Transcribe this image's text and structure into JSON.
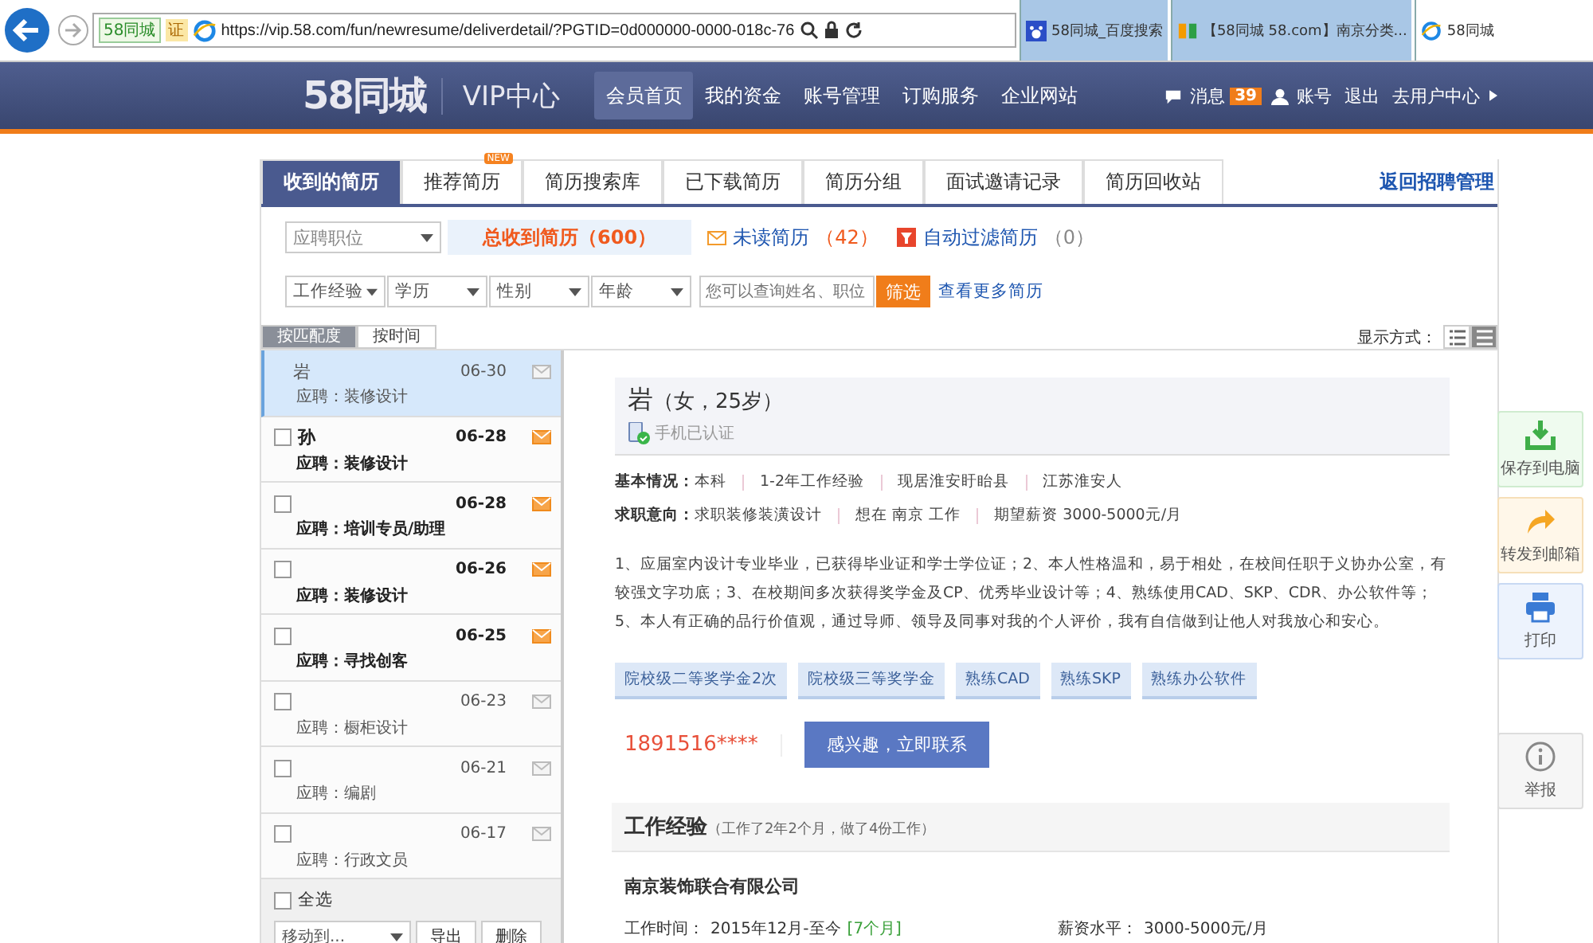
{
  "browser": {
    "site_badge": "58同城",
    "cert": "证",
    "url": "https://vip.58.com/fun/newresume/deliverdetail/?PGTID=0d000000-0000-018c-76",
    "tabs": [
      {
        "title": "58同城_百度搜索",
        "selected": false,
        "kind": "paw"
      },
      {
        "title": "【58同城 58.com】南京分类...",
        "selected": false,
        "kind": "logo58"
      },
      {
        "title": "58同城",
        "selected": true,
        "kind": "ie"
      }
    ]
  },
  "header": {
    "logo": "58同城",
    "subtitle": "VIP中心",
    "nav": [
      {
        "label": "会员首页",
        "selected": true
      },
      {
        "label": "我的资金",
        "selected": false
      },
      {
        "label": "账号管理",
        "selected": false
      },
      {
        "label": "订购服务",
        "selected": false
      },
      {
        "label": "企业网站",
        "selected": false
      }
    ],
    "messages": "消息",
    "message_count": "39",
    "account": "账号",
    "logout": "退出",
    "user_center": "去用户中心"
  },
  "tabs": [
    {
      "label": "收到的简历",
      "selected": true
    },
    {
      "label": "推荐简历",
      "selected": false,
      "badge": "NEW"
    },
    {
      "label": "简历搜索库",
      "selected": false
    },
    {
      "label": "已下载简历",
      "selected": false
    },
    {
      "label": "简历分组",
      "selected": false
    },
    {
      "label": "面试邀请记录",
      "selected": false
    },
    {
      "label": "简历回收站",
      "selected": false
    }
  ],
  "back_link": "返回招聘管理",
  "filters": {
    "position": "应聘职位",
    "total": "总收到简历（600）",
    "unread_label": "未读简历",
    "unread_count": "（42）",
    "filtered_label": "自动过滤简历",
    "filtered_count": "（0）",
    "dropdowns": [
      "工作经验",
      "学历",
      "性别",
      "年龄"
    ],
    "search_placeholder": "您可以查询姓名、职位",
    "search_button": "筛选",
    "more": "查看更多简历"
  },
  "sort": [
    {
      "label": "按匹配度",
      "selected": true
    },
    {
      "label": "按时间",
      "selected": false
    }
  ],
  "display_mode": "显示方式：",
  "list": [
    {
      "name": "岩",
      "position": "应聘：装修设计",
      "date": "06-30",
      "unread": false,
      "selected": true
    },
    {
      "name": "孙",
      "position": "应聘：装修设计",
      "date": "06-28",
      "unread": true,
      "selected": false
    },
    {
      "position": "应聘：培训专员/助理",
      "date": "06-28",
      "unread": true,
      "selected": false
    },
    {
      "position": "应聘：装修设计",
      "date": "06-26",
      "unread": true,
      "selected": false
    },
    {
      "position": "应聘：寻找创客",
      "date": "06-25",
      "unread": true,
      "selected": false
    },
    {
      "position": "应聘：橱柜设计",
      "date": "06-23",
      "unread": false,
      "selected": false
    },
    {
      "position": "应聘：编剧",
      "date": "06-21",
      "unread": false,
      "selected": false
    },
    {
      "position": "应聘：行政文员",
      "date": "06-17",
      "unread": false,
      "selected": false
    }
  ],
  "list_footer": {
    "select_all": "全选",
    "select_all_checked": false,
    "move": "移动到...",
    "export": "导出",
    "delete": "删除"
  },
  "resume": {
    "name": "岩",
    "meta": "（女，25岁）",
    "verified": "手机已认证",
    "basic_label": "基本情况：",
    "basic": [
      "本科",
      "1-2年工作经验",
      "现居淮安盱眙县",
      "江苏淮安人"
    ],
    "intent_label": "求职意向：",
    "intent": [
      "求职装修装潢设计",
      "想在 南京 工作",
      "期望薪资 3000-5000元/月"
    ],
    "summary": "1、应届室内设计专业毕业，已获得毕业证和学士学位证；2、本人性格温和，易于相处，在校间任职于义协办公室，有较强文字功底；3、在校期间多次获得奖学金及CP、优秀毕业设计等；4、熟练使用CAD、SKP、CDR、办公软件等；5、本人有正确的品行价值观，通过导师、领导及同事对我的个人评价，我有自信做到让他人对我放心和安心。",
    "tags": [
      "院校级二等奖学金2次",
      "院校级三等奖学金",
      "熟练CAD",
      "熟练SKP",
      "熟练办公软件"
    ],
    "phone": "1891516****",
    "contact_button": "感兴趣，立即联系",
    "work_title": "工作经验",
    "work_note": "（工作了2年2个月，做了4份工作）",
    "company": "南京装饰联合有限公司",
    "work_time_label": "工作时间：",
    "work_time": "2015年12月-至今",
    "work_duration": "[7个月]",
    "salary_label": "薪资水平：",
    "salary": "3000-5000元/月"
  },
  "side_actions": [
    {
      "label": "保存到电脑",
      "kind": "download"
    },
    {
      "label": "转发到邮箱",
      "kind": "forward"
    },
    {
      "label": "打印",
      "kind": "print"
    },
    {
      "label": "举报",
      "kind": "report"
    }
  ]
}
